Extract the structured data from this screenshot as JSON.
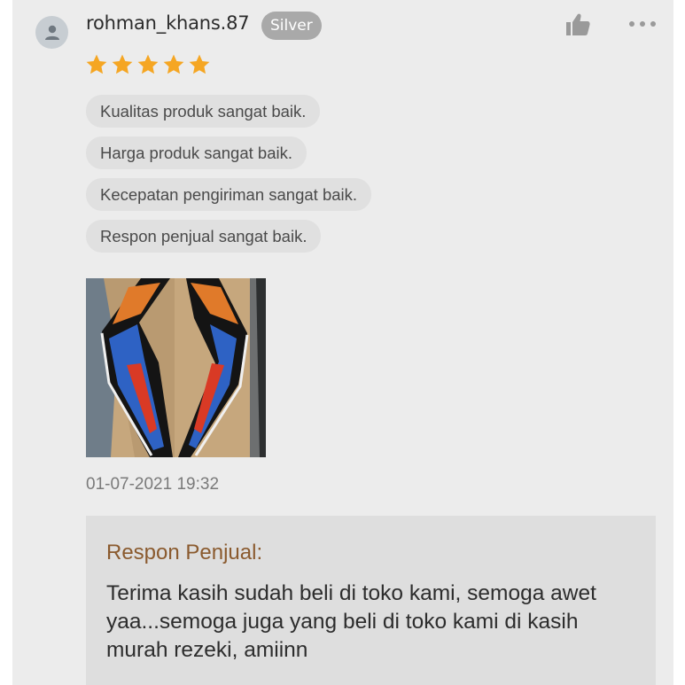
{
  "review": {
    "username": "rohman_khans.87",
    "badge": "Silver",
    "rating": 5,
    "tags": [
      "Kualitas produk sangat baik.",
      "Harga produk sangat baik.",
      "Kecepatan pengiriman sangat baik.",
      "Respon penjual sangat baik."
    ],
    "timestamp": "01-07-2021 19:32",
    "icons": {
      "avatar": "user-avatar-icon",
      "like": "thumbs-up-icon",
      "more": "more-dots-icon",
      "star": "star-icon"
    },
    "colors": {
      "star": "#f5a623",
      "badge": "#a9a9a9",
      "seller_title": "#8a5a2e"
    }
  },
  "seller_response": {
    "title": "Respon Penjual:",
    "text": "Terima kasih sudah beli di toko kami, semoga awet yaa...semoga juga yang beli di toko kami di kasih murah rezeki, amiinn"
  }
}
